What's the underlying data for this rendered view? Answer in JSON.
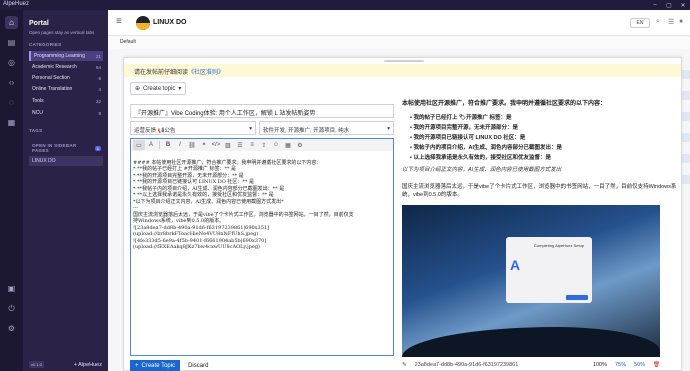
{
  "window": {
    "title": "AlpeHuez"
  },
  "rail": {
    "icons": [
      "home-icon",
      "inbox-icon",
      "globe-icon",
      "code-icon",
      "chat-icon",
      "grid-icon",
      "lock-icon",
      "power-icon",
      "gear-icon"
    ]
  },
  "sidebar": {
    "portal_title": "Portal",
    "portal_subtitle": "Open pages stay as vertical tabs",
    "categories_header": "CATEGORIES",
    "categories": [
      {
        "label": "Programming Learning",
        "count": "21"
      },
      {
        "label": "Academic Research",
        "count": "64"
      },
      {
        "label": "Personal Section",
        "count": "6"
      },
      {
        "label": "Online Translation",
        "count": "4"
      },
      {
        "label": "Tools",
        "count": "22"
      },
      {
        "label": "NCU",
        "count": "8"
      }
    ],
    "tags_header": "TAGS",
    "open_header": "OPEN IN SIDEBAR PAGES",
    "open_count": "1",
    "open_item": "LINUX DO",
    "version": "v0.1.0",
    "add_label": "+ AlpeHuez"
  },
  "header": {
    "site_name": "LINUX DO",
    "lang": "EN"
  },
  "subbar": {
    "default_label": "Default"
  },
  "composer": {
    "notice_prefix": "请在发帖前仔细阅读",
    "notice_link": "《社区准则》",
    "create_topic_label": "Create topic",
    "title_value": "『开源推广』Vibe Coding体验: 用个人工作区，解锁 L 站发帖新姿势",
    "category_value": "运营反馈 📢公告",
    "tags_value": "软件开发, 开源推广, 开源项目, 纯水",
    "editor_lines": [
      "#### 本帖使用社区开源推广，符合推广要求。我申明并遵循社区要求的以下内容：",
      "* **我的帖子已经打上 #开源推广 标签：** 是",
      "* **我的开源项目完整开源，无未开源部分：** 是",
      "* **我的开源项目已链接认可 LINUX DO 社区：** 是",
      "* **我帖子内的项目介绍，AI生成、润色内容部分已截图发出：** 是",
      "* **以上选择我承诺是永久有效的，接受社区和优友监督：** 是",
      "",
      "*以下为项目介绍正文内容，AI生成、润色内容已使用截图方式发出*",
      "",
      "---",
      "国庆主流浏览器落后太远，于是vibe了个卡片式工作区，浏览器中的书签网站，一目了然，目前仅支",
      "持Windows系统，vibe到0.5.0的版本。",
      "![23a8dea7-dd8b-490a-91d6-f63197239861|690x351]",
      "(upload://br8brkFToacHieNe4VU8nNFfUhS.jpeg)",
      "![4fe333d5-6e9a-4f5b-9401-f6661904ab5b|690x370]",
      "(upload://fEXEAakq8JKz7bw4cxwUU8cAOLy.jpeg)"
    ],
    "create_button": "Create Topic",
    "discard_button": "Discard"
  },
  "preview": {
    "heading": "本帖使用社区开源推广，符合推广要求。我申明并遵循社区要求的以下内容：",
    "items": [
      "我的帖子已经打上 🏷开源推广 标签：是",
      "我的开源项目完整开源，无未开源部分：是",
      "我的开源项目已链接认可 LINUX DO 社区：是",
      "我帖子内的项目介绍，AI生成、润色内容部分已截图发出：是",
      "以上选择我承诺是永久有效的，接受社区和优友监督：是"
    ],
    "italic": "以下为项目介绍正文内容，AI生成、润色内容已使用截图方式发出",
    "paragraph": "国庆主流浏览器落后太远，于是vibe了个卡片式工作区，浏览器中的书签网站，一目了然，目前仅支持Windows系统，vibe到0.5.0的版本。",
    "dialog_title": "Completing AlpeHuez Setup",
    "image_name": "23a8dea7-dd8b-490a-91d6-f63197239861",
    "zoom_levels": [
      "100%",
      "75%",
      "50%"
    ]
  }
}
